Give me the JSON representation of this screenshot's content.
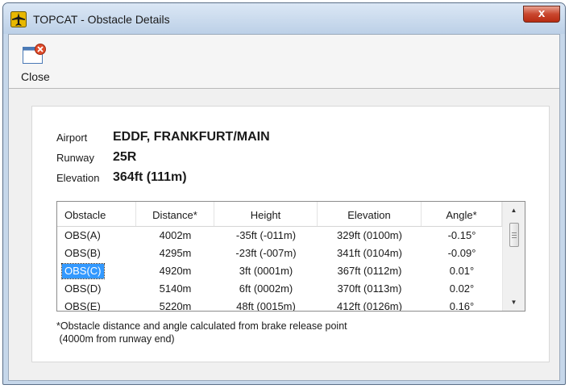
{
  "window": {
    "title": "TOPCAT - Obstacle Details",
    "close_glyph": "x"
  },
  "toolbar": {
    "close_label": "Close",
    "close_icon": "window-close-icon"
  },
  "info": {
    "airport_label": "Airport",
    "airport_value": "EDDF, FRANKFURT/MAIN",
    "runway_label": "Runway",
    "runway_value": "25R",
    "elevation_label": "Elevation",
    "elevation_value": "364ft (111m)"
  },
  "table": {
    "columns": [
      "Obstacle",
      "Distance*",
      "Height",
      "Elevation",
      "Angle*"
    ],
    "rows": [
      [
        "OBS(A)",
        "4002m",
        "-35ft (-011m)",
        "329ft (0100m)",
        "-0.15°"
      ],
      [
        "OBS(B)",
        "4295m",
        "-23ft (-007m)",
        "341ft (0104m)",
        "-0.09°"
      ],
      [
        "OBS(C)",
        "4920m",
        "3ft (0001m)",
        "367ft (0112m)",
        "0.01°"
      ],
      [
        "OBS(D)",
        "5140m",
        "6ft (0002m)",
        "370ft (0113m)",
        "0.02°"
      ],
      [
        "OBS(E)",
        "5220m",
        "48ft (0015m)",
        "412ft (0126m)",
        "0.16°"
      ]
    ],
    "selected_row": 2
  },
  "footnote": {
    "line1": "*Obstacle distance and angle calculated from brake release point",
    "line2": " (4000m from runway end)"
  },
  "colors": {
    "selection": "#3399ff",
    "title_close": "#c9472e"
  }
}
